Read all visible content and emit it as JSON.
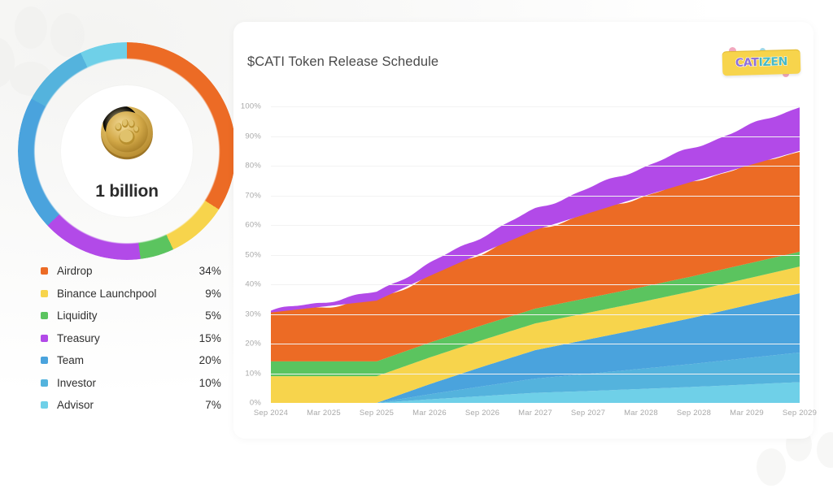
{
  "page": {
    "background_color": "#ffffff",
    "panel_color": "#ffffff"
  },
  "donut": {
    "center_value": "1 billion",
    "coin_icon": "paw-coin-icon"
  },
  "legend": {
    "items": [
      {
        "label": "Airdrop",
        "percent": "34%",
        "value": 34,
        "color": "#ec6b25"
      },
      {
        "label": "Binance Launchpool",
        "percent": "9%",
        "value": 9,
        "color": "#f7d44c"
      },
      {
        "label": "Liquidity",
        "percent": "5%",
        "value": 5,
        "color": "#5bc45f"
      },
      {
        "label": "Treasury",
        "percent": "15%",
        "value": 15,
        "color": "#b24ae8"
      },
      {
        "label": "Team",
        "percent": "20%",
        "value": 20,
        "color": "#4aa3dd"
      },
      {
        "label": "Investor",
        "percent": "10%",
        "value": 10,
        "color": "#54b3dd"
      },
      {
        "label": "Advisor",
        "percent": "7%",
        "value": 7,
        "color": "#6fd0e8"
      }
    ]
  },
  "panel": {
    "title": "$CATI Token Release Schedule",
    "logo": {
      "text_a": "CAT",
      "text_b": "IZEN",
      "name": "catizen-logo"
    }
  },
  "chart_data": {
    "type": "area",
    "title": "$CATI Token Release Schedule",
    "xlabel": "",
    "ylabel": "",
    "ylim": [
      0,
      100
    ],
    "grid": true,
    "stacked": true,
    "legend_position": "left-external",
    "ytick_labels": [
      "0%",
      "10%",
      "20%",
      "30%",
      "40%",
      "50%",
      "60%",
      "70%",
      "80%",
      "90%",
      "100%"
    ],
    "ytick_values": [
      0,
      10,
      20,
      30,
      40,
      50,
      60,
      70,
      80,
      90,
      100
    ],
    "xtick_labels": [
      "Sep 2024",
      "Mar 2025",
      "Sep 2025",
      "Mar 2026",
      "Sep 2026",
      "Mar 2027",
      "Sep 2027",
      "Mar 2028",
      "Sep 2028",
      "Mar 2029",
      "Sep 2029"
    ],
    "x": [
      0,
      6,
      12,
      18,
      24,
      30,
      36,
      42,
      48,
      54,
      60
    ],
    "stack_order": [
      "Advisor",
      "Investor",
      "Team",
      "Binance Launchpool",
      "Liquidity",
      "Airdrop",
      "Treasury"
    ],
    "series": [
      {
        "name": "Advisor",
        "color": "#6fd0e8",
        "values": [
          0,
          0,
          0,
          1.2,
          2.3,
          3.4,
          4.0,
          4.7,
          5.4,
          6.2,
          7
        ]
      },
      {
        "name": "Investor",
        "color": "#54b3dd",
        "values": [
          0,
          0,
          0,
          1.7,
          3.3,
          4.8,
          5.8,
          6.8,
          7.8,
          8.9,
          10
        ]
      },
      {
        "name": "Team",
        "color": "#4aa3dd",
        "values": [
          0,
          0,
          0,
          3.4,
          6.6,
          9.6,
          11.6,
          13.5,
          15.6,
          17.8,
          20
        ]
      },
      {
        "name": "Binance Launchpool",
        "color": "#f7d44c",
        "values": [
          9,
          9,
          9,
          9,
          9,
          9,
          9,
          9,
          9,
          9,
          9
        ]
      },
      {
        "name": "Liquidity",
        "color": "#5bc45f",
        "values": [
          5,
          5,
          5,
          5,
          5,
          5,
          5,
          5,
          5,
          5,
          5
        ]
      },
      {
        "name": "Airdrop",
        "color": "#ec6b25",
        "values": [
          16.5,
          18.5,
          20.5,
          22.5,
          24.5,
          26.5,
          28.5,
          30.5,
          32,
          33,
          34
        ]
      },
      {
        "name": "Treasury",
        "color": "#b24ae8",
        "values": [
          0.6,
          1.6,
          2.8,
          4.2,
          5.6,
          7.0,
          8.4,
          9.8,
          11.3,
          13.2,
          15
        ]
      }
    ],
    "totals": [
      31.1,
      34.1,
      37.3,
      47.0,
      56.3,
      65.3,
      72.3,
      79.3,
      86.1,
      93.1,
      100
    ]
  }
}
